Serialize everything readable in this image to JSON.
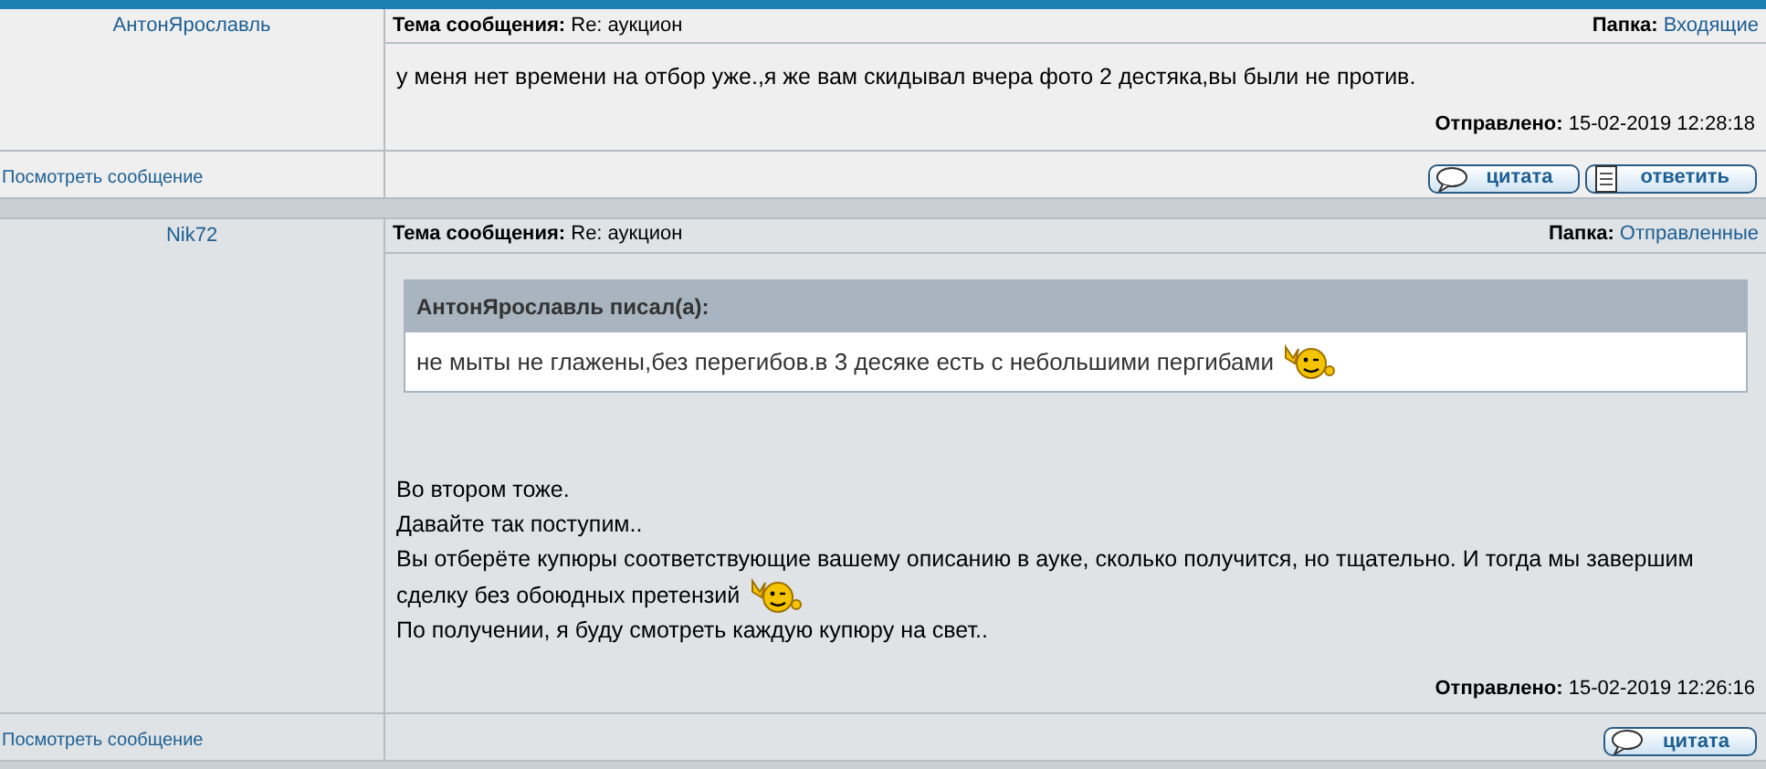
{
  "messages": [
    {
      "author": "АнтонЯрославль",
      "subject_label": "Тема сообщения:",
      "subject": "Re: аукцион",
      "folder_label": "Папка:",
      "folder": "Входящие",
      "lines": [
        {
          "text": "у меня нет времени на отбор уже.,я же вам скидывал вчера фото 2 дестяка,вы были не против.",
          "smiley": false
        }
      ],
      "sent_label": "Отправлено:",
      "sent": "15-02-2019 12:28:18",
      "view_link": "Посмотреть сообщение",
      "buttons": [
        {
          "kind": "quote",
          "label": "цитата"
        },
        {
          "kind": "reply",
          "label": "ответить"
        }
      ]
    },
    {
      "author": "Nik72",
      "subject_label": "Тема сообщения:",
      "subject": "Re: аукцион",
      "folder_label": "Папка:",
      "folder": "Отправленные",
      "quote": {
        "header": "АнтонЯрославль писал(а):",
        "text": "не мыты не глажены,без перегибов.в 3 десяке есть с небольшими пергибами",
        "smiley": true
      },
      "lines": [
        {
          "text": "Во втором тоже.",
          "smiley": false
        },
        {
          "text": "Давайте так поступим..",
          "smiley": false
        },
        {
          "text": "Вы отберёте купюры соответствующие вашему описанию в ауке, сколько получится, но тщательно. И тогда мы завершим сделку без обоюдных претензий",
          "smiley": true
        },
        {
          "text": "По получении, я буду смотреть каждую купюру на свет..",
          "smiley": false
        }
      ],
      "sent_label": "Отправлено:",
      "sent": "15-02-2019 12:26:16",
      "view_link": "Посмотреть сообщение",
      "buttons": [
        {
          "kind": "quote",
          "label": "цитата"
        }
      ]
    }
  ]
}
